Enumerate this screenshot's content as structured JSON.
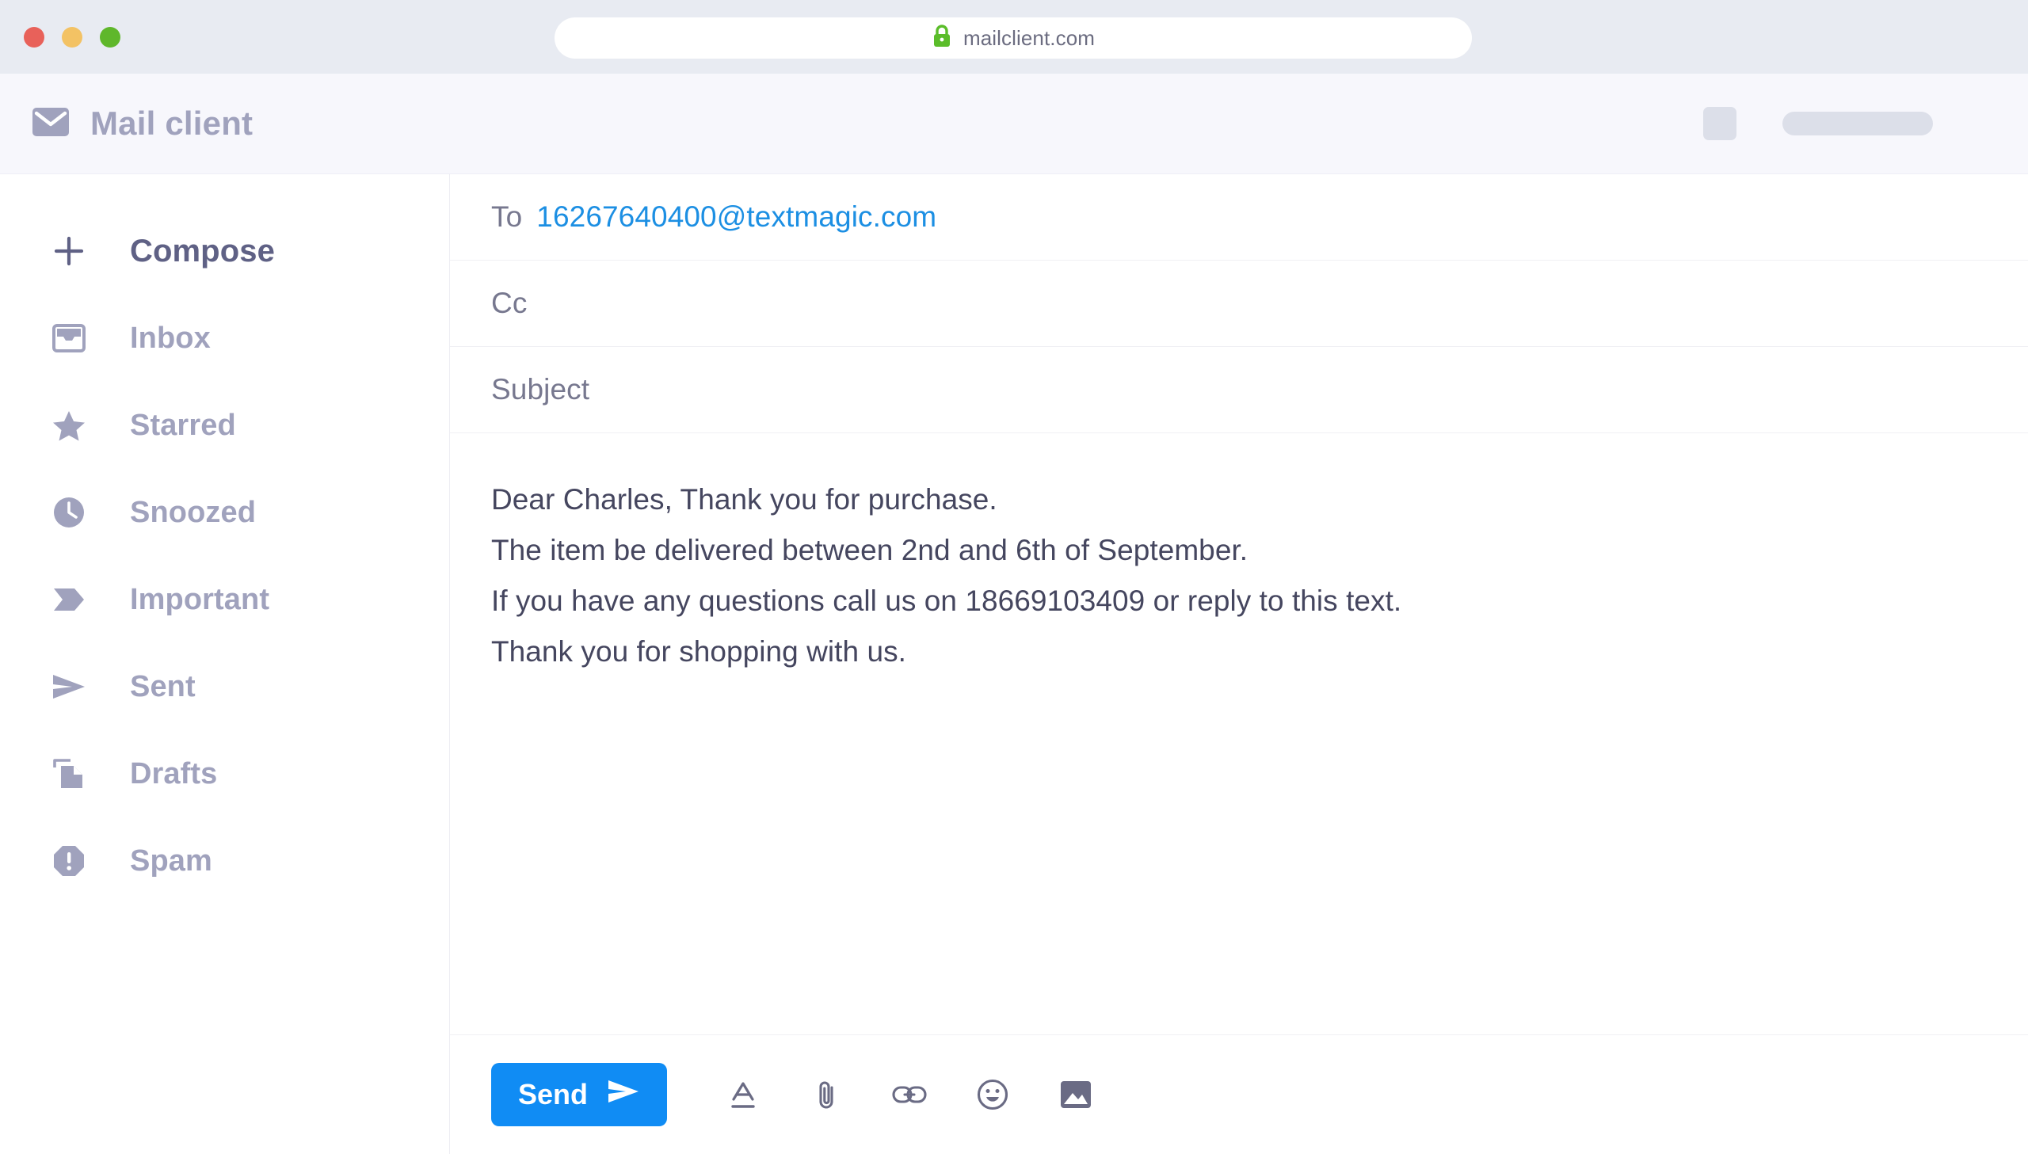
{
  "browser": {
    "traffic_lights": [
      {
        "name": "close",
        "color": "#e8615a"
      },
      {
        "name": "minimize",
        "color": "#f3c264"
      },
      {
        "name": "maximize",
        "color": "#5fb72b"
      }
    ],
    "url": "mailclient.com",
    "lock_icon": "lock-icon",
    "lock_color": "#5bbd2a",
    "chrome_color": "#e8ebf2"
  },
  "header": {
    "logo_icon": "envelope-icon",
    "brand": "Mail client",
    "brand_color": "#a0a2bd",
    "background": "#f7f7fc",
    "placeholders": [
      {
        "name": "skeleton-square",
        "shape": "square"
      },
      {
        "name": "skeleton-bar",
        "shape": "bar"
      }
    ]
  },
  "sidebar": {
    "items": [
      {
        "label": "Compose",
        "icon": "plus-icon",
        "primary": true
      },
      {
        "label": "Inbox",
        "icon": "inbox-icon",
        "primary": false
      },
      {
        "label": "Starred",
        "icon": "star-icon",
        "primary": false
      },
      {
        "label": "Snoozed",
        "icon": "clock-icon",
        "primary": false
      },
      {
        "label": "Important",
        "icon": "label-icon",
        "primary": false
      },
      {
        "label": "Sent",
        "icon": "send-icon",
        "primary": false
      },
      {
        "label": "Drafts",
        "icon": "documents-icon",
        "primary": false
      },
      {
        "label": "Spam",
        "icon": "spam-icon",
        "primary": false
      }
    ]
  },
  "compose": {
    "to_label": "To",
    "to_value": "16267640400@textmagic.com",
    "to_value_color": "#1c8fe3",
    "cc_placeholder": "Cc",
    "subject_placeholder": "Subject",
    "body_lines": [
      "Dear Charles, Thank you for purchase.",
      "The item be delivered between 2nd and 6th of September.",
      "If you have any questions call us on 18669103409 or reply to this text.",
      "Thank you for shopping with us."
    ]
  },
  "toolbar": {
    "send_label": "Send",
    "send_color": "#108cf4",
    "send_icon": "paper-plane-icon",
    "icons": [
      {
        "name": "text-format-icon"
      },
      {
        "name": "attachment-icon"
      },
      {
        "name": "link-icon"
      },
      {
        "name": "emoji-icon"
      },
      {
        "name": "insert-image-icon"
      }
    ]
  }
}
